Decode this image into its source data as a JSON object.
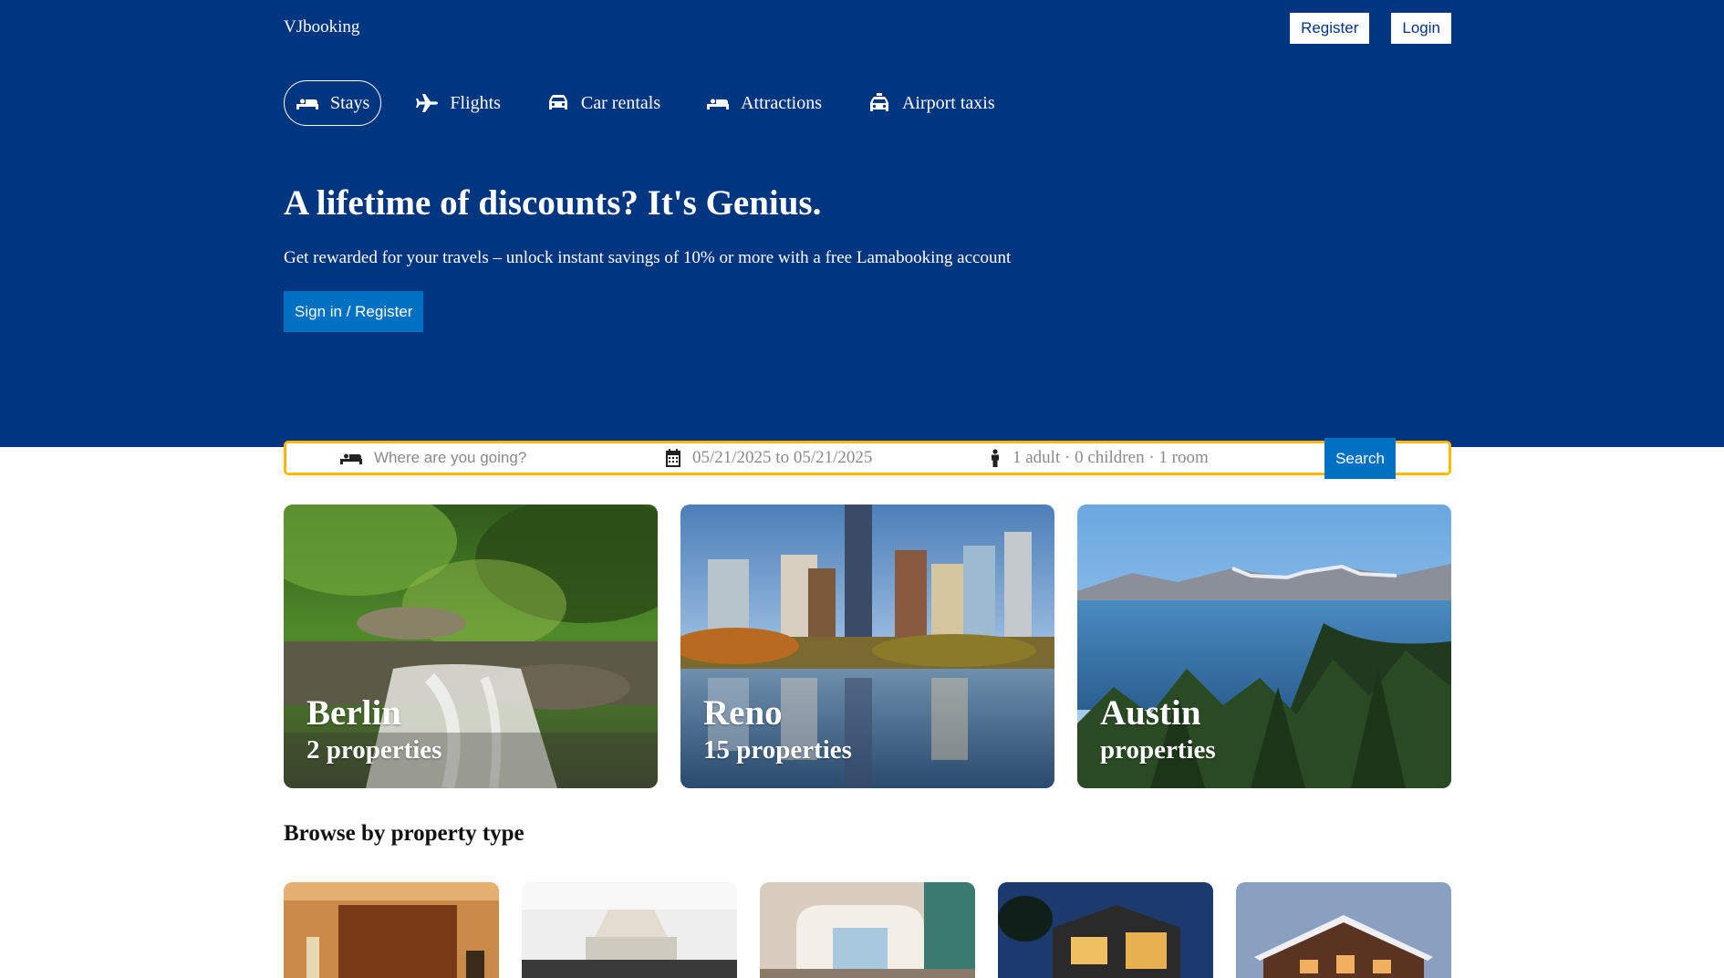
{
  "brand": {
    "logo": "VJbooking"
  },
  "top_actions": {
    "register": "Register",
    "login": "Login"
  },
  "nav": {
    "items": [
      {
        "label": "Stays",
        "icon": "bed-icon",
        "active": true
      },
      {
        "label": "Flights",
        "icon": "plane-icon",
        "active": false
      },
      {
        "label": "Car rentals",
        "icon": "car-icon",
        "active": false
      },
      {
        "label": "Attractions",
        "icon": "bed-icon",
        "active": false
      },
      {
        "label": "Airport taxis",
        "icon": "taxi-icon",
        "active": false
      }
    ]
  },
  "hero": {
    "title": "A lifetime of discounts? It's Genius.",
    "subtitle": "Get rewarded for your travels – unlock instant savings of 10% or more with a free Lamabooking account",
    "cta": "Sign in / Register"
  },
  "search": {
    "destination_placeholder": "Where are you going?",
    "dates": "05/21/2025 to 05/21/2025",
    "guests": "1 adult · 0 children · 1 room",
    "button": "Search"
  },
  "featured": [
    {
      "city": "Berlin",
      "count": "2 properties"
    },
    {
      "city": "Reno",
      "count": "15 properties"
    },
    {
      "city": "Austin",
      "count": "properties"
    }
  ],
  "browse": {
    "title": "Browse by property type",
    "cards": [
      "hotel-image",
      "apartment-image",
      "resort-image",
      "villa-image",
      "cabin-image"
    ]
  },
  "colors": {
    "header_bg": "#003580",
    "accent_blue": "#0071c2",
    "search_border": "#febb02"
  }
}
